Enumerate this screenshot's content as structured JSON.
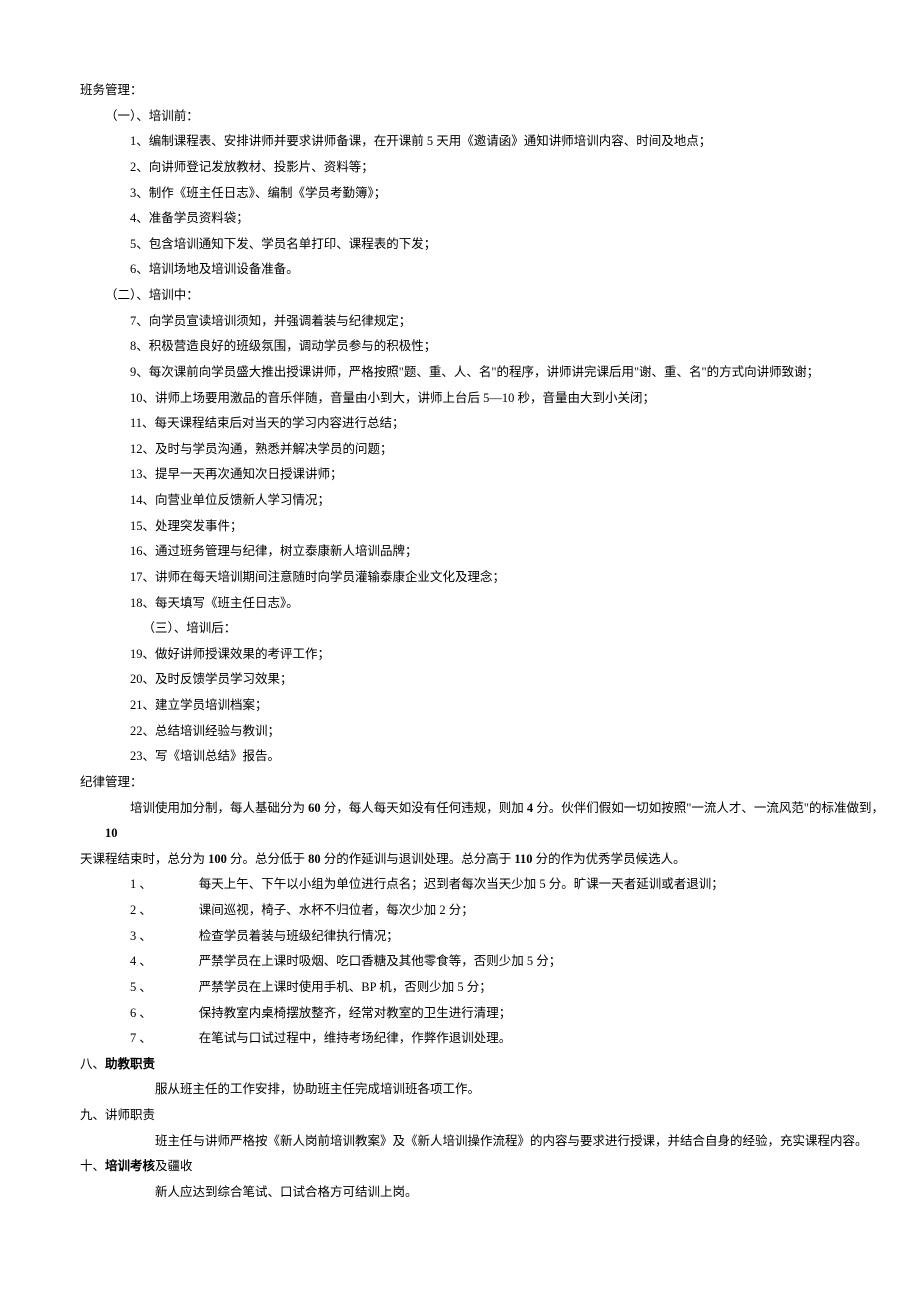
{
  "banwu_heading": "班务管理：",
  "s1_heading": "（一）、培训前：",
  "s1_items": [
    "1、编制课程表、安排讲师并要求讲师备课，在开课前 5 天用《邀请函》通知讲师培训内容、时间及地点；",
    "2、向讲师登记发放教材、投影片、资料等；",
    "3、制作《班主任日志》、编制《学员考勤簿》；",
    "4、准备学员资料袋；",
    "5、包含培训通知下发、学员名单打印、课程表的下发；",
    "6、培训场地及培训设备准备。"
  ],
  "s2_heading": "（二）、培训中：",
  "s2_items": [
    "7、向学员宣读培训须知，并强调着装与纪律规定；",
    "8、积极营造良好的班级氛围，调动学员参与的积极性；",
    "9、每次课前向学员盛大推出授课讲师，严格按照\"题、重、人、名\"的程序，讲师讲完课后用\"谢、重、名\"的方式向讲师致谢；",
    "10、讲师上场要用激品的音乐伴随，音量由小到大，讲师上台后 5—10 秒，音量由大到小关闭；",
    "11、每天课程结束后对当天的学习内容进行总结；",
    "12、及时与学员沟通，熟悉并解决学员的问题；",
    "13、提早一天再次通知次日授课讲师；",
    "14、向营业单位反馈新人学习情况；",
    "15、处理突发事件；",
    "16、通过班务管理与纪律，树立泰康新人培训品牌；",
    "17、讲师在每天培训期间注意随时向学员灌输泰康企业文化及理念；",
    "18、每天填写《班主任日志》。"
  ],
  "s3_heading": "（三）、培训后：",
  "s3_items": [
    "19、做好讲师授课效果的考评工作；",
    "20、及时反馈学员学习效果；",
    "21、建立学员培训档案；",
    "22、总结培训经验与教训；",
    "23、写《培训总结》报告。"
  ],
  "jilu_heading": "纪律管理：",
  "jilu_intro_a": "培训使用加分制，每人基础分为 ",
  "jilu_intro_b": "60",
  "jilu_intro_c": " 分，每人每天如没有任何违规，则加 ",
  "jilu_intro_d": "4",
  "jilu_intro_e": " 分。伙伴们假如一切如按照\"一流人才、一流风范\"的标准做到，",
  "jilu_intro_f": "10",
  "jilu_line2_a": "天课程结束时，总分为 ",
  "jilu_line2_b": "100",
  "jilu_line2_c": " 分。总分低于 ",
  "jilu_line2_d": "80",
  "jilu_line2_e": " 分的作延训与退训处理。总分高于 ",
  "jilu_line2_f": "110",
  "jilu_line2_g": " 分的作为优秀学员候选人。",
  "jilu_items": [
    "每天上午、下午以小组为单位进行点名；迟到者每次当天少加 5 分。旷课一天者延训或者退训；",
    "课间巡视，椅子、水杯不归位者，每次少加 2 分；",
    "检查学员着装与班级纪律执行情况；",
    "严禁学员在上课时吸烟、吃口香糖及其他零食等，否则少加 5 分；",
    "严禁学员在上课时使用手机、BP 机，否则少加 5 分；",
    "保持教室内桌椅摆放整齐，经常对教室的卫生进行清理；",
    "在笔试与口试过程中，维持考场纪律，作弊作退训处理。"
  ],
  "jilu_idx": [
    "1 、",
    "2 、",
    "3 、",
    "4 、",
    "5 、",
    "6 、",
    "7 、"
  ],
  "h8_pre": "八、",
  "h8_bold": "助教职责",
  "h8_body": "服从班主任的工作安排，协助班主任完成培训班各项工作。",
  "h9_full": "九、讲师职责",
  "h9_body": "班主任与讲师严格按《新人岗前培训教案》及《新人培训操作流程》的内容与要求进行授课，并结合自身的经验，充实课程内容。",
  "h10_pre": "十、",
  "h10_bold": "培训考核",
  "h10_suffix": "及疆收",
  "h10_body": "新人应达到综合笔试、口试合格方可结训上岗。"
}
